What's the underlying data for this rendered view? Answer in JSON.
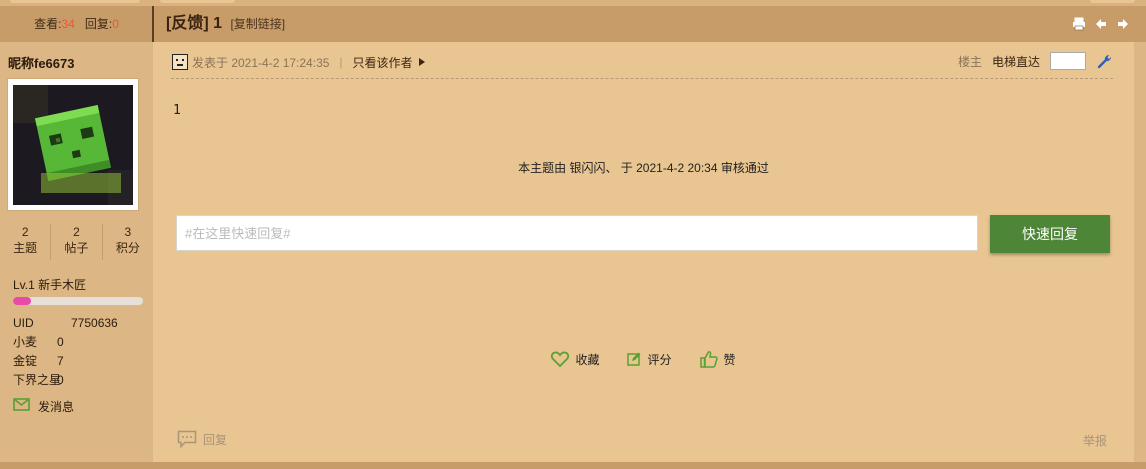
{
  "header": {
    "views_label": "查看:",
    "views_count": "34",
    "replies_label": "回复:",
    "replies_count": "0",
    "thread_title": "[反馈] 1",
    "copy_link": "[复制链接]"
  },
  "author": {
    "name": "昵称fe6673",
    "stats": [
      {
        "value": "2",
        "label": "主题"
      },
      {
        "value": "2",
        "label": "帖子"
      },
      {
        "value": "3",
        "label": "积分"
      }
    ],
    "level": "Lv.1 新手木匠",
    "level_progress": 0.14,
    "info": [
      {
        "key": "UID",
        "value": "7750636"
      },
      {
        "key": "小麦",
        "value": "0"
      },
      {
        "key": "金锭",
        "value": "7"
      },
      {
        "key": "下界之星",
        "value": "0"
      }
    ],
    "send_message": "发消息"
  },
  "post": {
    "posted_at": "发表于 2021-4-2 17:24:35",
    "only_author": "只看该作者",
    "floor": "楼主",
    "elevator": "电梯直达",
    "content": "1",
    "approved": "本主题由 银闪闪、 于 2021-4-2 20:34 审核通过",
    "reply_placeholder": "#在这里快速回复#",
    "reply_button": "快速回复",
    "actions": {
      "favorite": "收藏",
      "rate": "评分",
      "like": "赞"
    },
    "reply": "回复",
    "report": "举报"
  },
  "colors": {
    "accent_green": "#4e8638",
    "count_red": "#e85a3a",
    "level_pink": "#e94aa8",
    "icon_green": "#5aa032"
  }
}
